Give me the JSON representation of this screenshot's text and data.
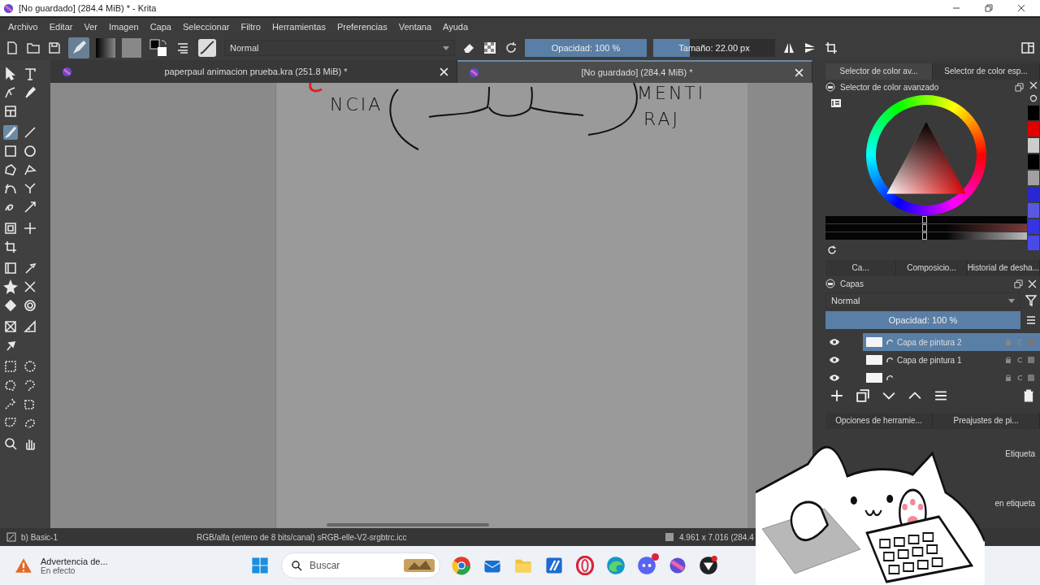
{
  "window": {
    "title": "[No guardado]  (284.4 MiB) * - Krita"
  },
  "menu": [
    "Archivo",
    "Editar",
    "Ver",
    "Imagen",
    "Capa",
    "Seleccionar",
    "Filtro",
    "Herramientas",
    "Preferencias",
    "Ventana",
    "Ayuda"
  ],
  "toolbar": {
    "blend_mode": "Normal",
    "opacity": {
      "label": "Opacidad: 100 %",
      "level": 1
    },
    "size": {
      "label": "Tamaño: 22.00 px",
      "level": 0.3
    }
  },
  "documents": [
    {
      "title": "paperpaul animacion prueba.kra (251.8 MiB) *",
      "selected": false
    },
    {
      "title": "[No guardado]  (284.4 MiB) *",
      "selected": true
    }
  ],
  "sketch": {
    "texts": [
      "NCIA",
      "MENTI",
      "RAJ"
    ]
  },
  "tool_groups": [
    [
      {
        "kind": "pointer",
        "selected": false
      },
      {
        "kind": "text",
        "selected": false
      },
      {
        "kind": "edit",
        "selected": false
      },
      {
        "kind": "pen",
        "selected": false
      },
      {
        "kind": "grid",
        "selected": false
      }
    ],
    [
      {
        "kind": "brush",
        "selected": true
      },
      {
        "kind": "line",
        "selected": false
      },
      {
        "kind": "rectangle",
        "selected": false
      },
      {
        "kind": "ellipse",
        "selected": false
      },
      {
        "kind": "polygon",
        "selected": false
      },
      {
        "kind": "polyline",
        "selected": false
      },
      {
        "kind": "bezier",
        "selected": false
      },
      {
        "kind": "path",
        "selected": false
      },
      {
        "kind": "curve",
        "selected": false
      },
      {
        "kind": "multibrush",
        "selected": false
      }
    ],
    [
      {
        "kind": "transform",
        "selected": false
      },
      {
        "kind": "move",
        "selected": false
      },
      {
        "kind": "crop",
        "selected": false
      }
    ],
    [
      {
        "kind": "gradient",
        "selected": false
      },
      {
        "kind": "picker",
        "selected": false
      },
      {
        "kind": "patch",
        "selected": false
      },
      {
        "kind": "cross",
        "selected": false
      },
      {
        "kind": "fill",
        "selected": false
      },
      {
        "kind": "gear",
        "selected": false
      }
    ],
    [
      {
        "kind": "assistant",
        "selected": false
      },
      {
        "kind": "measure",
        "selected": false
      },
      {
        "kind": "pin",
        "selected": false
      }
    ],
    [
      {
        "kind": "rect-select",
        "selected": false
      },
      {
        "kind": "ellipse-select",
        "selected": false
      },
      {
        "kind": "poly-select",
        "selected": false
      },
      {
        "kind": "free-select",
        "selected": false
      },
      {
        "kind": "wand-select",
        "selected": false
      },
      {
        "kind": "similar-select",
        "selected": false
      },
      {
        "kind": "bezier-select",
        "selected": false
      },
      {
        "kind": "magnetic-select",
        "selected": false
      }
    ],
    [
      {
        "kind": "zoom",
        "selected": false
      },
      {
        "kind": "pan",
        "selected": false
      }
    ]
  ],
  "right_panel": {
    "top_tabs": [
      {
        "label": "Selector de color av...",
        "selected": true
      },
      {
        "label": "Selector de color esp...",
        "selected": false
      }
    ],
    "color_selector": {
      "title": "Selector de color avanzado"
    },
    "color_sliders": [
      {
        "level": 0.48
      },
      {
        "level": 0.48
      },
      {
        "level": 0.48
      }
    ],
    "palette": [
      {
        "color": "#000000"
      },
      {
        "color": "#e00000"
      },
      {
        "color": "#cccccc"
      },
      {
        "color": "#000000"
      },
      {
        "color": "#a0a0a0"
      },
      {
        "color": "#2828d0"
      },
      {
        "color": "#5858e0"
      },
      {
        "color": "#3434e0"
      },
      {
        "color": "#4a4aea"
      }
    ],
    "mid_tabs": [
      {
        "label": "Ca...",
        "selected": false
      },
      {
        "label": "Composicio...",
        "selected": false
      },
      {
        "label": "Historial de desha...",
        "selected": false
      }
    ],
    "layers": {
      "title": "Capas",
      "blend_mode": "Normal",
      "opacity": {
        "label": "Opacidad: 100 %",
        "level": 1
      },
      "items": [
        {
          "name": "Capa de pintura 2",
          "visible": true,
          "selected": true
        },
        {
          "name": "Capa de pintura 1",
          "visible": true,
          "selected": false
        },
        {
          "visible": true,
          "selected": false
        }
      ]
    },
    "bottom_tabs": [
      {
        "label": "Opciones de herramie...",
        "selected": false
      },
      {
        "label": "Preajustes de pi...",
        "selected": false
      }
    ],
    "presets": {
      "tag_label": "Etiqueta",
      "search_label": "en etiqueta"
    }
  },
  "status_bar": {
    "brush": "b) Basic-1",
    "color_space": "RGB/alfa (entero de 8 bits/canal)  sRGB-elle-V2-srgbtrc.icc",
    "size": "4.961 x 7.016 (284.4"
  },
  "taskbar": {
    "notification": {
      "title": "Advertencia de...",
      "subtitle": "En efecto"
    },
    "search_placeholder": "Buscar"
  }
}
